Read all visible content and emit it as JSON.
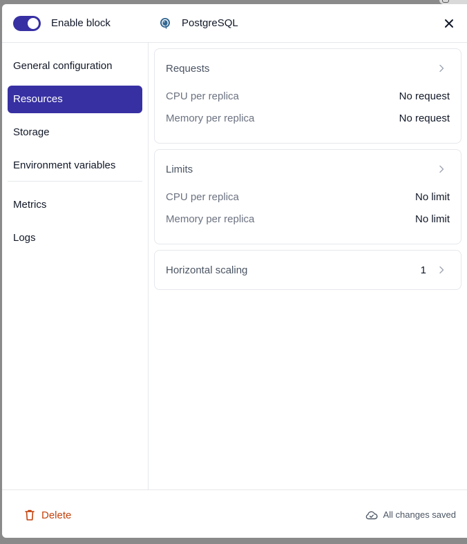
{
  "header": {
    "toggle_label": "Enable block",
    "toggle_on": true,
    "service_name": "PostgreSQL",
    "service_icon": "postgresql-elephant-icon",
    "close_icon": "close-icon"
  },
  "sidebar": {
    "items": [
      {
        "label": "General configuration",
        "active": false
      },
      {
        "label": "Resources",
        "active": true
      },
      {
        "label": "Storage",
        "active": false
      },
      {
        "label": "Environment variables",
        "active": false
      },
      {
        "label": "Metrics",
        "active": false
      },
      {
        "label": "Logs",
        "active": false
      }
    ]
  },
  "requests": {
    "title": "Requests",
    "rows": [
      {
        "label": "CPU per replica",
        "value": "No request"
      },
      {
        "label": "Memory per replica",
        "value": "No request"
      }
    ]
  },
  "limits": {
    "title": "Limits",
    "rows": [
      {
        "label": "CPU per replica",
        "value": "No limit"
      },
      {
        "label": "Memory per replica",
        "value": "No limit"
      }
    ]
  },
  "scaling": {
    "title": "Horizontal scaling",
    "value": "1"
  },
  "footer": {
    "delete_label": "Delete",
    "status": "All changes saved"
  },
  "colors": {
    "accent": "#3730a3",
    "danger": "#c2410c"
  }
}
